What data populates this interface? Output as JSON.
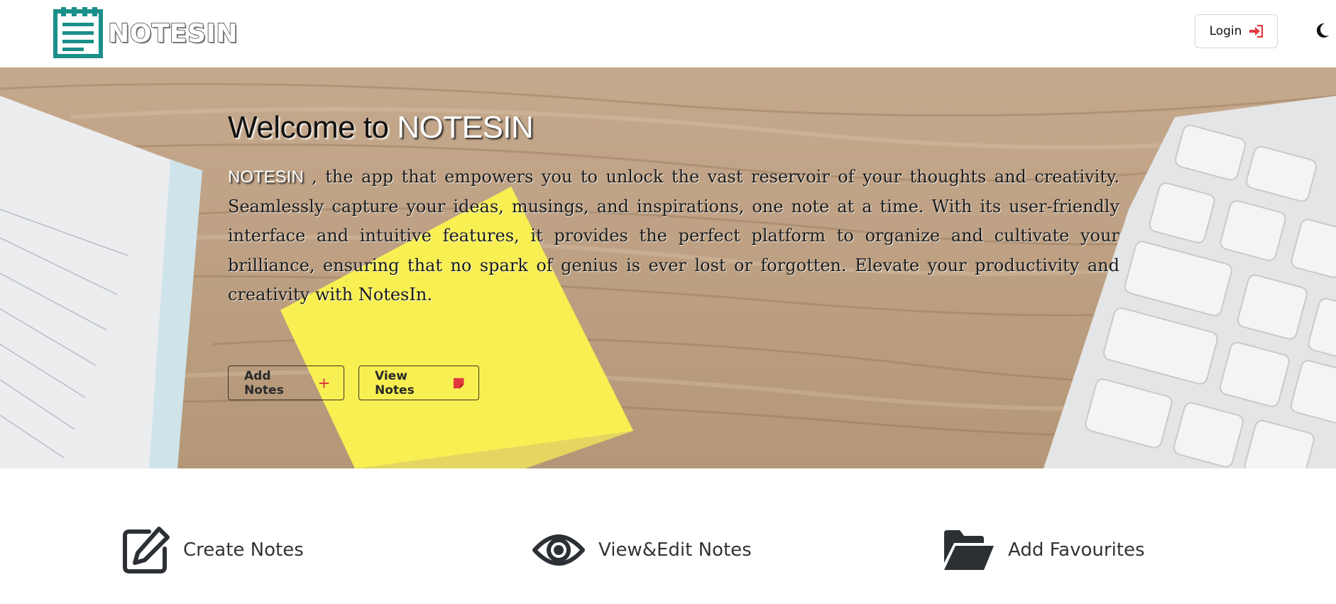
{
  "navbar": {
    "brand": "NOTESIN",
    "login_label": "Login",
    "icons": {
      "brand": "notepad-icon",
      "login": "sign-in-icon",
      "theme": "moon-icon"
    }
  },
  "hero": {
    "title_prefix": "Welcome to ",
    "title_accent": "NOTESIN",
    "desc_brand": "NOTESIN",
    "description": " , the app that empowers you to unlock the vast reservoir of your thoughts and creativity. Seamlessly capture your ideas, musings, and inspirations, one note at a time. With its user-friendly interface and intuitive features, it provides the perfect platform to organize and cultivate your brilliance, ensuring that no spark of genius is ever lost or forgotten. Elevate your productivity and creativity with NotesIn.",
    "add_notes_label": "Add Notes",
    "view_notes_label": "View Notes",
    "icons": {
      "add": "plus-icon",
      "view": "sticky-note-icon"
    }
  },
  "features": [
    {
      "label": "Create Notes",
      "icon": "edit-icon"
    },
    {
      "label": "View&Edit Notes",
      "icon": "eye-icon"
    },
    {
      "label": "Add Favourites",
      "icon": "folder-open-icon"
    }
  ],
  "colors": {
    "brand_teal": "#1a8f8a",
    "accent_red": "#e0393e",
    "dark_icon": "#2c3035"
  }
}
